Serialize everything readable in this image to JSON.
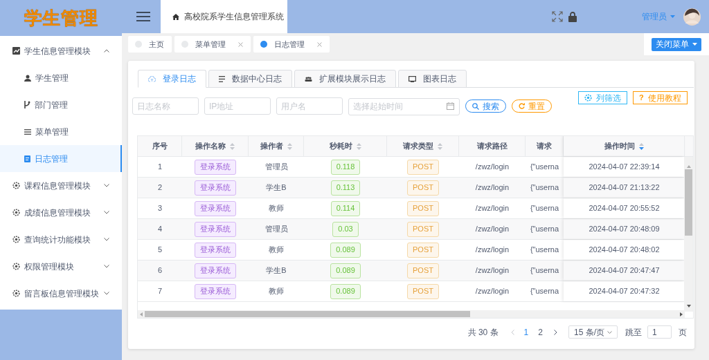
{
  "logo": "学生管理",
  "header": {
    "breadcrumb": "高校院系学生信息管理系统",
    "user": "管理员"
  },
  "sidebar": {
    "items": [
      {
        "label": "学生信息管理模块",
        "expanded": true,
        "children": [
          {
            "label": "学生管理",
            "selected": false
          },
          {
            "label": "部门管理",
            "selected": false
          },
          {
            "label": "菜单管理",
            "selected": false
          },
          {
            "label": "日志管理",
            "selected": true
          }
        ]
      },
      {
        "label": "课程信息管理模块",
        "expanded": false
      },
      {
        "label": "成绩信息管理模块",
        "expanded": false
      },
      {
        "label": "查询统计功能模块",
        "expanded": false
      },
      {
        "label": "权限管理模块",
        "expanded": false
      },
      {
        "label": "留言板信息管理模块",
        "expanded": false
      }
    ]
  },
  "page_tags": [
    {
      "label": "主页",
      "selected": false,
      "closable": false
    },
    {
      "label": "菜单管理",
      "selected": false,
      "closable": true
    },
    {
      "label": "日志管理",
      "selected": true,
      "closable": true
    }
  ],
  "close_menu_button": "关闭菜单",
  "tabs": [
    {
      "label": "登录日志",
      "selected": true
    },
    {
      "label": "数据中心日志",
      "selected": false
    },
    {
      "label": "扩展模块展示日志",
      "selected": false
    },
    {
      "label": "图表日志",
      "selected": false
    }
  ],
  "filters": [
    {
      "placeholder": "日志名称",
      "kind": "text"
    },
    {
      "placeholder": "IP地址",
      "kind": "text"
    },
    {
      "placeholder": "用户名",
      "kind": "text"
    },
    {
      "placeholder": "选择起始时间",
      "kind": "date"
    }
  ],
  "search_button": "搜索",
  "reset_button": "重置",
  "column_filter_button": "列筛选",
  "tutorial_icon": "?",
  "tutorial_button": "使用教程",
  "table": {
    "columns": [
      {
        "label": "序号",
        "sortable": false
      },
      {
        "label": "操作名称",
        "sortable": true,
        "sorted_desc": false
      },
      {
        "label": "操作者",
        "sortable": true,
        "sorted_desc": false
      },
      {
        "label": "秒耗时",
        "sortable": true,
        "sorted_desc": false
      },
      {
        "label": "请求类型",
        "sortable": true,
        "sorted_desc": false
      },
      {
        "label": "请求路径",
        "sortable": false
      },
      {
        "label": "请求",
        "sortable": false
      },
      {
        "label": "操作时间",
        "sortable": true,
        "sorted_desc": true
      }
    ],
    "rows": [
      [
        "1",
        "登录系统",
        "管理员",
        "0.118",
        "POST",
        "/zwz/login",
        "{\"userna",
        "2024-04-07 22:39:14"
      ],
      [
        "2",
        "登录系统",
        "学生B",
        "0.113",
        "POST",
        "/zwz/login",
        "{\"userna",
        "2024-04-07 21:13:22"
      ],
      [
        "3",
        "登录系统",
        "教师",
        "0.114",
        "POST",
        "/zwz/login",
        "{\"userna",
        "2024-04-07 20:55:52"
      ],
      [
        "4",
        "登录系统",
        "管理员",
        "0.03",
        "POST",
        "/zwz/login",
        "{\"userna",
        "2024-04-07 20:48:09"
      ],
      [
        "5",
        "登录系统",
        "教师",
        "0.089",
        "POST",
        "/zwz/login",
        "{\"userna",
        "2024-04-07 20:48:02"
      ],
      [
        "6",
        "登录系统",
        "学生B",
        "0.089",
        "POST",
        "/zwz/login",
        "{\"userna",
        "2024-04-07 20:47:47"
      ],
      [
        "7",
        "登录系统",
        "教师",
        "0.089",
        "POST",
        "/zwz/login",
        "{\"userna",
        "2024-04-07 20:47:32"
      ]
    ]
  },
  "pagination": {
    "total": "共 30 条",
    "pages": [
      {
        "label": "1",
        "selected": true
      },
      {
        "label": "2",
        "selected": false
      }
    ],
    "page_size": "15 条/页",
    "jump_label": "跳至",
    "jump_value": "1",
    "page_suffix": "页"
  }
}
